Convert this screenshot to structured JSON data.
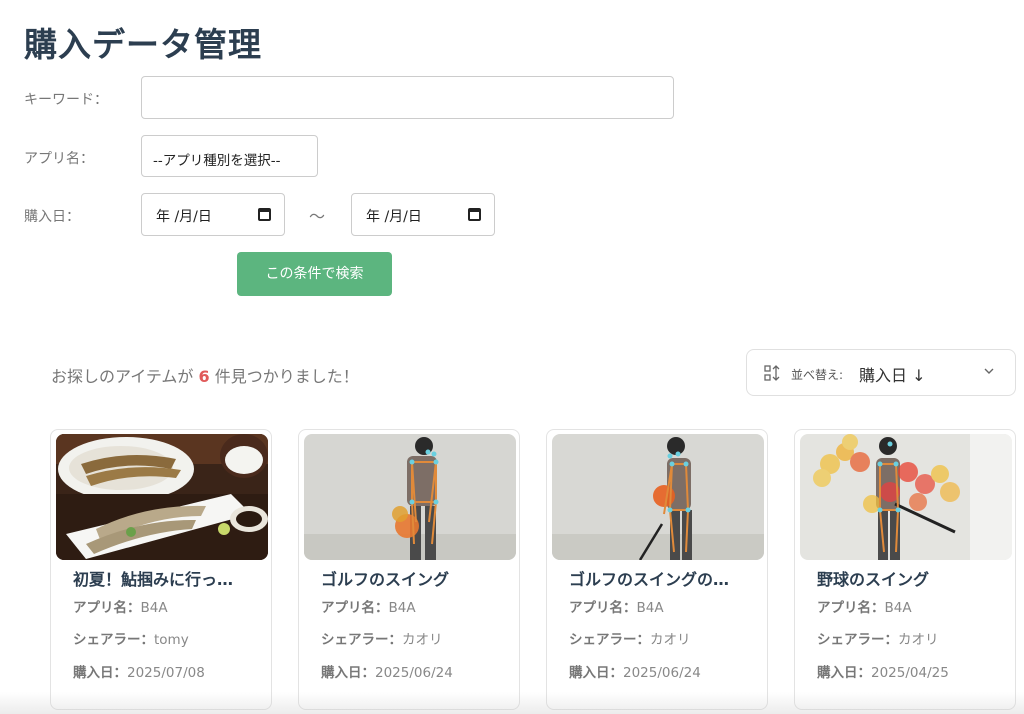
{
  "page": {
    "title": "購入データ管理"
  },
  "search": {
    "keyword_label": "キーワード：",
    "keyword_value": "",
    "app_label": "アプリ名：",
    "app_select_value": "--アプリ種別を選択--",
    "date_label": "購入日：",
    "date_from": "年 /月/日",
    "date_to": "年 /月/日",
    "date_separator": "〜",
    "submit_label": "この条件で検索"
  },
  "results": {
    "prefix": "お探しのアイテムが",
    "count": "6",
    "suffix": "件見つかりました！"
  },
  "sort": {
    "label": "並べ替え:",
    "value": "購入日 ↓"
  },
  "meta_labels": {
    "app": "アプリ名：",
    "sharer": "シェアラー：",
    "date": "購入日："
  },
  "cards": [
    {
      "title": "初夏！鮎掴みに行っ…",
      "app": "B4A",
      "sharer": "tomy",
      "date": "2025/07/08"
    },
    {
      "title": "ゴルフのスイング",
      "app": "B4A",
      "sharer": "カオリ",
      "date": "2025/06/24"
    },
    {
      "title": "ゴルフのスイングの…",
      "app": "B4A",
      "sharer": "カオリ",
      "date": "2025/06/24"
    },
    {
      "title": "野球のスイング",
      "app": "B4A",
      "sharer": "カオリ",
      "date": "2025/04/25"
    }
  ]
}
